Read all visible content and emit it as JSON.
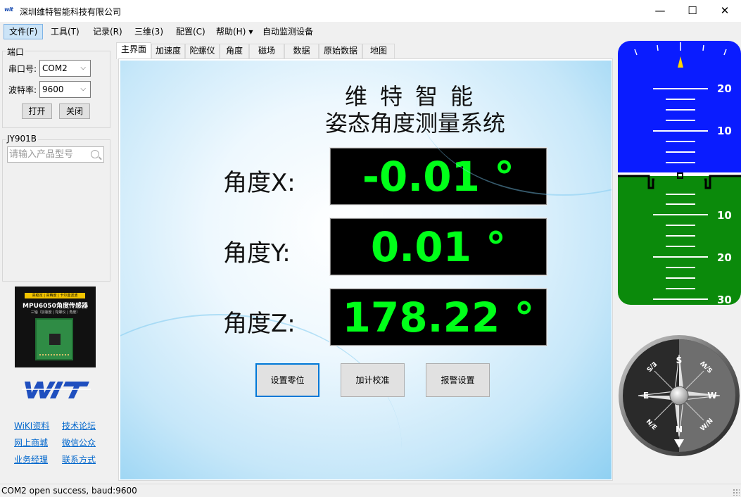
{
  "window": {
    "title": "深圳维特智能科技有限公司",
    "logo_text": "wit",
    "controls": {
      "minimize": "—",
      "maximize": "☐",
      "close": "✕"
    }
  },
  "menu": {
    "items": [
      {
        "label": "文件(F)"
      },
      {
        "label": "工具(T)"
      },
      {
        "label": "记录(R)"
      },
      {
        "label": "三维(3)"
      },
      {
        "label": "配置(C)"
      },
      {
        "label": "帮助(H)"
      },
      {
        "label": "自动监测设备"
      }
    ]
  },
  "port_group": {
    "title": "端口",
    "serial_label": "串口号:",
    "serial_value": "COM2",
    "baud_label": "波特率:",
    "baud_value": "9600",
    "open_label": "打开",
    "close_label": "关闭"
  },
  "model_group": {
    "title": "JY901B",
    "search_placeholder": "请输入产品型号"
  },
  "product_card": {
    "tag_line": "高稳定 | 高精度 | 卡尔曼滤波",
    "title": "MPU6050角度传感器",
    "subtitle": "三轴（加速度 | 陀螺仪 | 角度）"
  },
  "links": [
    {
      "label": "WiKI资料"
    },
    {
      "label": "技术论坛"
    },
    {
      "label": "网上商城"
    },
    {
      "label": "微信公众"
    },
    {
      "label": "业务经理"
    },
    {
      "label": "联系方式"
    }
  ],
  "tabs": [
    {
      "label": "主界面"
    },
    {
      "label": "加速度"
    },
    {
      "label": "陀螺仪"
    },
    {
      "label": "角度"
    },
    {
      "label": "磁场"
    },
    {
      "label": "数据"
    },
    {
      "label": "原始数据"
    },
    {
      "label": "地图"
    }
  ],
  "main": {
    "heading_line1": "维特智能",
    "heading_line2": "姿态角度测量系统",
    "angles": [
      {
        "label": "角度X:",
        "value": "-0.01 °"
      },
      {
        "label": "角度Y:",
        "value": "0.01 °"
      },
      {
        "label": "角度Z:",
        "value": "178.22 °"
      }
    ],
    "buttons": [
      {
        "label": "设置零位"
      },
      {
        "label": "加计校准"
      },
      {
        "label": "报警设置"
      }
    ]
  },
  "horizon": {
    "sky_color": "#0a1cff",
    "ground_color": "#0b8a0b",
    "pitch_labels_up": [
      "20",
      "10"
    ],
    "pitch_labels_down": [
      "10",
      "20",
      "30"
    ]
  },
  "compass": {
    "heading_deg": 178.22,
    "cardinals": {
      "n": "N",
      "e": "E",
      "s": "S",
      "w": "W"
    },
    "intercardinals": {
      "ne": "N/E",
      "se": "E/S",
      "sw": "S/W",
      "nw": "W/N"
    }
  },
  "status": {
    "text": "COM2 open success, baud:9600"
  },
  "colors": {
    "display_text": "#00ff19",
    "display_bg": "#000000",
    "link": "#0066cc",
    "focus_border": "#0078d7"
  }
}
